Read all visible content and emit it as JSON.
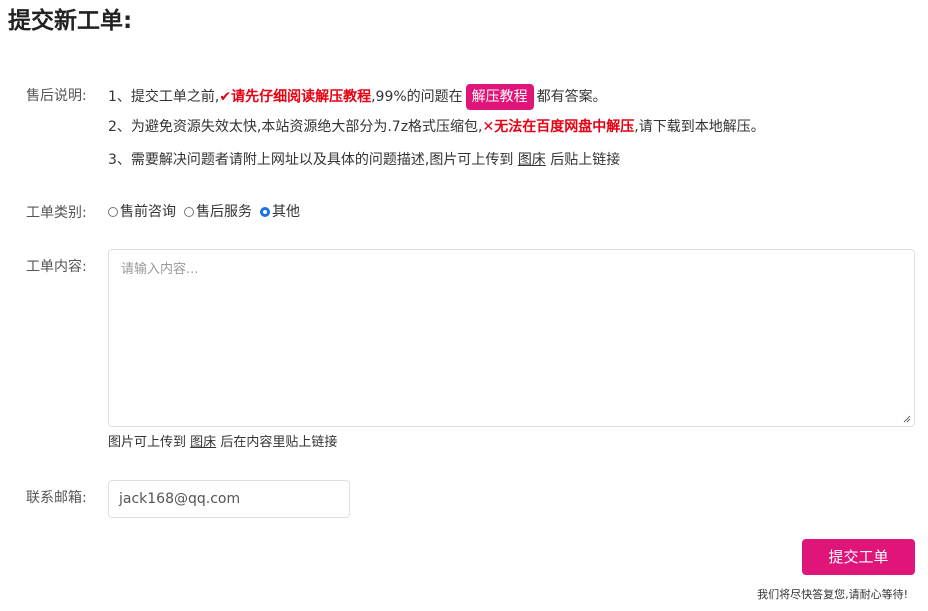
{
  "page": {
    "title": "提交新工单:"
  },
  "notice": {
    "label": "售后说明:",
    "line1": {
      "prefix": "1、提交工单之前,",
      "warn": "✔请先仔细阅读解压教程",
      "middle": ",99%的问题在",
      "button_label": "解压教程",
      "suffix": "都有答案。"
    },
    "line2": {
      "prefix": "2、为避免资源失效太快,本站资源绝大部分为.7z格式压缩包,",
      "warn": "✕无法在百度网盘中解压",
      "suffix": ",请下载到本地解压。"
    },
    "line3": {
      "prefix": "3、需要解决问题者请附上网址以及具体的问题描述,图片可上传到",
      "link": "图床",
      "suffix": "后贴上链接"
    }
  },
  "ticket_type": {
    "label": "工单类别:",
    "options": [
      {
        "label": "售前咨询",
        "checked": false
      },
      {
        "label": "售后服务",
        "checked": false
      },
      {
        "label": "其他",
        "checked": true
      }
    ]
  },
  "content": {
    "label": "工单内容:",
    "placeholder": "请输入内容...",
    "value": "",
    "hint_prefix": "图片可上传到",
    "hint_link": "图床",
    "hint_suffix": "后在内容里贴上链接"
  },
  "email": {
    "label": "联系邮箱:",
    "value": "jack168@qq.com"
  },
  "submit": {
    "label": "提交工单",
    "note": "我们将尽快答复您,请耐心等待!"
  },
  "colors": {
    "accent": "#e0157a",
    "warning": "#e60012",
    "radio_checked": "#1a73e8"
  }
}
